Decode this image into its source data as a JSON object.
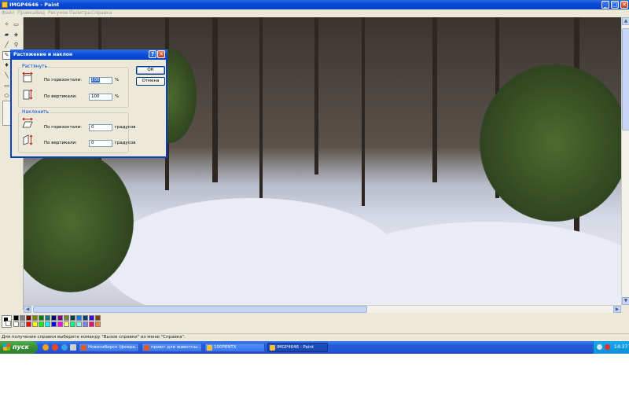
{
  "window": {
    "title": "IMGP4646 - Paint",
    "controls": {
      "minimize": "_",
      "maximize": "□",
      "close": "✕"
    }
  },
  "menu": {
    "items": [
      "Файл",
      "Правка",
      "Вид",
      "Рисунок",
      "Палитра",
      "Справка"
    ]
  },
  "toolbox": {
    "tools": [
      {
        "name": "free-select-icon",
        "glyph": "✧"
      },
      {
        "name": "rect-select-icon",
        "glyph": "▭"
      },
      {
        "name": "eraser-icon",
        "glyph": "▰"
      },
      {
        "name": "fill-icon",
        "glyph": "◈"
      },
      {
        "name": "eyedropper-icon",
        "glyph": "╱"
      },
      {
        "name": "magnifier-icon",
        "glyph": "⚲"
      },
      {
        "name": "pencil-icon",
        "glyph": "✎"
      },
      {
        "name": "brush-icon",
        "glyph": "♦"
      },
      {
        "name": "line-icon",
        "glyph": "╲"
      },
      {
        "name": "rectangle-icon",
        "glyph": "▭"
      },
      {
        "name": "ellipse-icon",
        "glyph": "⬭"
      }
    ]
  },
  "dialog": {
    "title": "Растяжение и наклон",
    "help_glyph": "?",
    "close_glyph": "✕",
    "stretch": {
      "legend": "Растянуть",
      "horizontal_label": "По горизонтали:",
      "horizontal_value": "100",
      "vertical_label": "По вертикали:",
      "vertical_value": "100",
      "unit": "%"
    },
    "skew": {
      "legend": "Наклонить",
      "horizontal_label": "По горизонтали:",
      "horizontal_value": "0",
      "vertical_label": "По вертикали:",
      "vertical_value": "0",
      "unit": "градусов"
    },
    "ok_label": "ОК",
    "cancel_label": "Отмена"
  },
  "palette": {
    "foreground": "#000000",
    "background": "#ffffff",
    "row1": [
      "#000000",
      "#808080",
      "#800000",
      "#808000",
      "#008000",
      "#008080",
      "#000080",
      "#800080",
      "#808040",
      "#004040",
      "#0080ff",
      "#004080",
      "#4000ff",
      "#804000"
    ],
    "row2": [
      "#ffffff",
      "#c0c0c0",
      "#ff0000",
      "#ffff00",
      "#00ff00",
      "#00ffff",
      "#0000ff",
      "#ff00ff",
      "#ffff80",
      "#00ff80",
      "#80ffff",
      "#8080ff",
      "#ff0080",
      "#ff8040"
    ]
  },
  "statusbar": {
    "text": "Для получения справки выберите команду \"Вызов справки\" из меню \"Справка\"."
  },
  "taskbar": {
    "start_label": "пуск",
    "tasks": [
      {
        "label": "Новосибирск (февра...",
        "icon_color": "#e05a2a",
        "active": false
      },
      {
        "label": "приют для животны...",
        "icon_color": "#e05a2a",
        "active": false
      },
      {
        "label": "100PENTX",
        "icon_color": "#f0c040",
        "active": false
      },
      {
        "label": "IMGP4646 - Paint",
        "icon_color": "#f0c040",
        "active": true
      }
    ],
    "clock": "14:37"
  }
}
